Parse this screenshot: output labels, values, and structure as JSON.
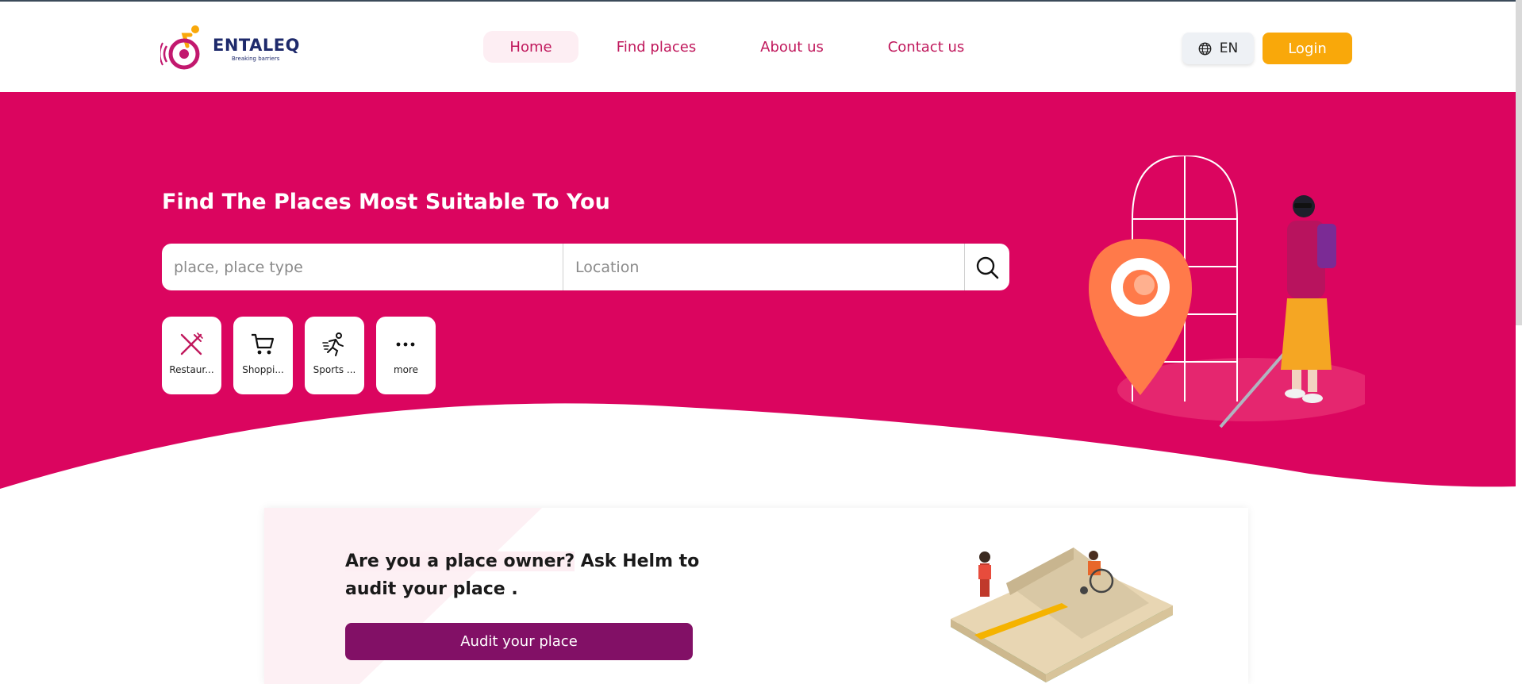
{
  "brand": {
    "name": "ENTALEQ",
    "tagline": "Breaking barriers"
  },
  "nav": {
    "items": [
      {
        "label": "Home",
        "active": true
      },
      {
        "label": "Find places",
        "active": false
      },
      {
        "label": "About us",
        "active": false
      },
      {
        "label": "Contact us",
        "active": false
      }
    ]
  },
  "header": {
    "language_label": "EN",
    "login_label": "Login"
  },
  "hero": {
    "title": "Find The Places Most Suitable To You",
    "search": {
      "place_placeholder": "place, place type",
      "location_placeholder": "Location",
      "button_icon": "search-icon"
    },
    "categories": [
      {
        "label": "Restaur...",
        "icon": "restaurant-icon"
      },
      {
        "label": "Shoppi...",
        "icon": "shopping-cart-icon"
      },
      {
        "label": "Sports ...",
        "icon": "sports-icon"
      },
      {
        "label": "more",
        "icon": "more-icon"
      }
    ]
  },
  "owner": {
    "question": "Are you a place owner? Ask Helm to audit your place .",
    "highlight": "Are you a place owner?",
    "rest": " Ask Helm to audit your place .",
    "button_label": "Audit your place"
  },
  "colors": {
    "primary": "#db055f",
    "accent": "#f9a80a",
    "audit_button": "#821066",
    "nav_text": "#c0185c"
  }
}
